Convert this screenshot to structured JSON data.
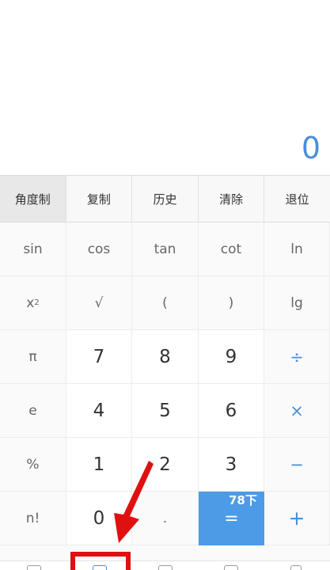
{
  "display": {
    "value": "0",
    "color": "#4a8fd9"
  },
  "function_row": [
    {
      "label": "角度制",
      "name": "angle-mode-button"
    },
    {
      "label": "复制",
      "name": "copy-button"
    },
    {
      "label": "历史",
      "name": "history-button"
    },
    {
      "label": "清除",
      "name": "clear-button"
    },
    {
      "label": "退位",
      "name": "backspace-button"
    }
  ],
  "keys": {
    "sin": "sin",
    "cos": "cos",
    "tan": "tan",
    "cot": "cot",
    "ln": "ln",
    "x": "x",
    "sq_exp": "2",
    "sqrt": "√",
    "lparen": "(",
    "rparen": ")",
    "lg": "lg",
    "pi": "π",
    "d7": "7",
    "d8": "8",
    "d9": "9",
    "divide": "÷",
    "e": "e",
    "d4": "4",
    "d5": "5",
    "d6": "6",
    "multiply": "×",
    "percent": "%",
    "d1": "1",
    "d2": "2",
    "d3": "3",
    "minus": "−",
    "factorial": "n!",
    "d0": "0",
    "dot": ".",
    "equals": "=",
    "plus": "+"
  },
  "watermark": "78下",
  "colors": {
    "accent": "#4a8fd9",
    "equals_bg": "#4d9be6",
    "annotation_red": "#e01010"
  },
  "icons": [
    "calculator-icon",
    "calculator-icon",
    "calculator-icon",
    "calculator-icon",
    "more-icon"
  ]
}
